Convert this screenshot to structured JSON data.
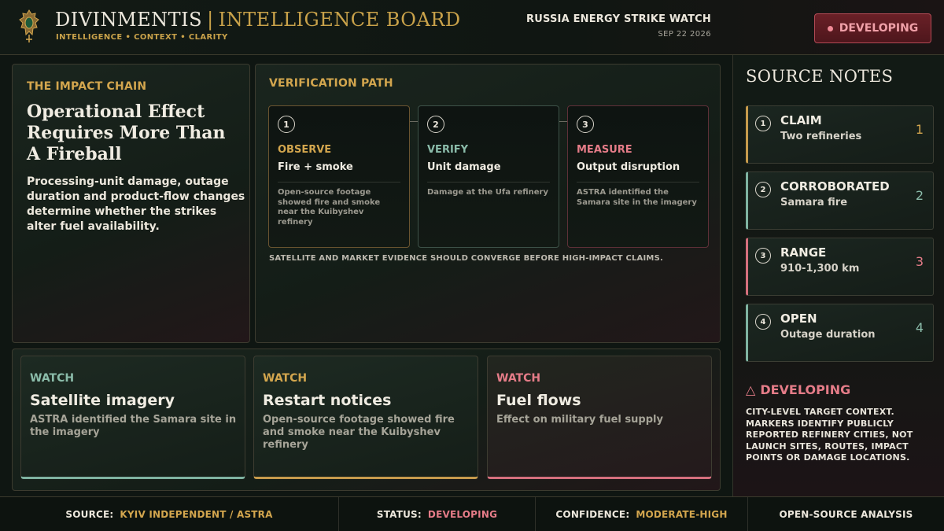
{
  "header": {
    "brand": "DIVINMENTIS",
    "brand_separator": "|",
    "board_title": "INTELLIGENCE BOARD",
    "tagline": "INTELLIGENCE • CONTEXT • CLARITY",
    "watch_title": "RUSSIA ENERGY STRIKE WATCH",
    "date": "SEP 22 2026",
    "status_button": "DEVELOPING",
    "crest_icon": "crest-emblem-icon"
  },
  "impact": {
    "kicker": "THE IMPACT CHAIN",
    "title": "Operational Effect Requires More Than A Fireball",
    "body": "Processing-unit damage, outage duration and product-flow changes determine whether the strikes alter fuel availability."
  },
  "verification": {
    "kicker": "VERIFICATION PATH",
    "steps": [
      {
        "num": "1",
        "kicker": "OBSERVE",
        "title": "Fire + smoke",
        "desc": "Open-source footage showed fire and smoke near the Kuibyshev refinery"
      },
      {
        "num": "2",
        "kicker": "VERIFY",
        "title": "Unit damage",
        "desc": "Damage at the Ufa refinery"
      },
      {
        "num": "3",
        "kicker": "MEASURE",
        "title": "Output disruption",
        "desc": "ASTRA identified the Samara site in the imagery"
      }
    ],
    "footer": "SATELLITE AND MARKET EVIDENCE SHOULD CONVERGE BEFORE HIGH-IMPACT CLAIMS."
  },
  "watch": [
    {
      "kicker": "WATCH",
      "title": "Satellite imagery",
      "body": "ASTRA identified the Samara site in the imagery"
    },
    {
      "kicker": "WATCH",
      "title": "Restart notices",
      "body": "Open-source footage showed fire and smoke near the Kuibyshev refinery"
    },
    {
      "kicker": "WATCH",
      "title": "Fuel flows",
      "body": "Effect on military fuel supply"
    }
  ],
  "sidebar": {
    "title": "SOURCE NOTES",
    "notes": [
      {
        "num": "1",
        "label": "CLAIM",
        "value": "Two refineries",
        "idx": "1"
      },
      {
        "num": "2",
        "label": "CORROBORATED",
        "value": "Samara fire",
        "idx": "2"
      },
      {
        "num": "3",
        "label": "RANGE",
        "value": "910-1,300 km",
        "idx": "3"
      },
      {
        "num": "4",
        "label": "OPEN",
        "value": "Outage duration",
        "idx": "4"
      }
    ],
    "warning_icon": "△",
    "warning_label": "DEVELOPING",
    "warning_desc": "CITY-LEVEL TARGET CONTEXT. MARKERS IDENTIFY PUBLICLY REPORTED REFINERY CITIES, NOT LAUNCH SITES, ROUTES, IMPACT POINTS OR DAMAGE LOCATIONS."
  },
  "footer": {
    "source_label": "SOURCE:",
    "source_value": "KYIV INDEPENDENT / ASTRA",
    "status_label": "STATUS:",
    "status_value": "DEVELOPING",
    "confidence_label": "CONFIDENCE:",
    "confidence_value": "MODERATE-HIGH",
    "analysis": "OPEN-SOURCE ANALYSIS"
  },
  "colors": {
    "gold": "#d3a64e",
    "teal": "#8bbcaa",
    "rose": "#e57c88",
    "background": "#0f1612"
  }
}
